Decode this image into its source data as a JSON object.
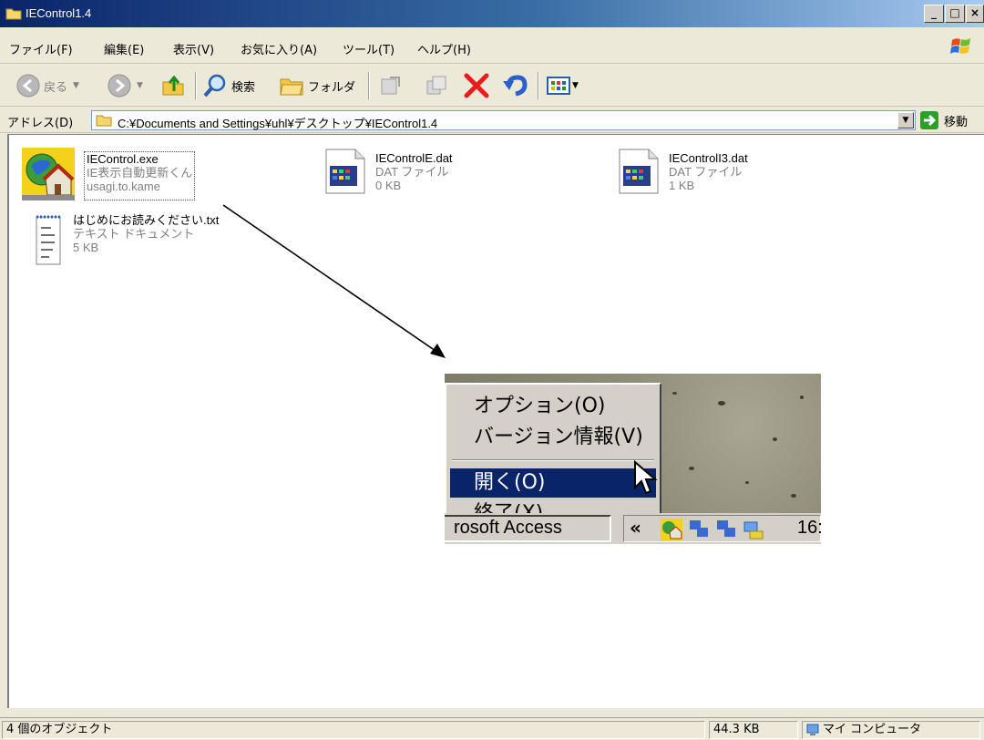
{
  "window": {
    "title": "IEControl1.4",
    "min_label": "_",
    "max_label": "□",
    "close_label": "×"
  },
  "menu": {
    "items": [
      "ファイル(F)",
      "編集(E)",
      "表示(V)",
      "お気に入り(A)",
      "ツール(T)",
      "ヘルプ(H)"
    ]
  },
  "toolbar": {
    "back_label": "戻る",
    "search_label": "検索",
    "folders_label": "フォルダ"
  },
  "address": {
    "label": "アドレス(D)",
    "path": "C:¥Documents and Settings¥uhl¥デスクトップ¥IEControl1.4",
    "go_label": "移動"
  },
  "files": [
    {
      "name": "IEControl.exe",
      "line2": "IE表示自動更新くん",
      "line3": "usagi.to.kame"
    },
    {
      "name": "IEControlE.dat",
      "line2": "DAT ファイル",
      "line3": "0 KB"
    },
    {
      "name": "IEControlI3.dat",
      "line2": "DAT ファイル",
      "line3": "1 KB"
    },
    {
      "name": "はじめにお読みください.txt",
      "line2": "テキスト ドキュメント",
      "line3": "5 KB"
    }
  ],
  "context_menu": {
    "items": [
      "オプション(O)",
      "バージョン情報(V)",
      "開く(O)",
      "終了(X)"
    ],
    "selected_index": 2
  },
  "inset_taskbar": {
    "task_text": "rosoft Access",
    "chevron": "«",
    "clock": "16:"
  },
  "status": {
    "objects": "4 個のオブジェクト",
    "size": "44.3 KB",
    "zone": "マイ コンピュータ"
  },
  "colors": {
    "title_start": "#0a246a",
    "title_end": "#a6caf0",
    "menu_selected": "#0a246a",
    "chrome": "#ece9d8",
    "close_x": "#e81c1c"
  }
}
